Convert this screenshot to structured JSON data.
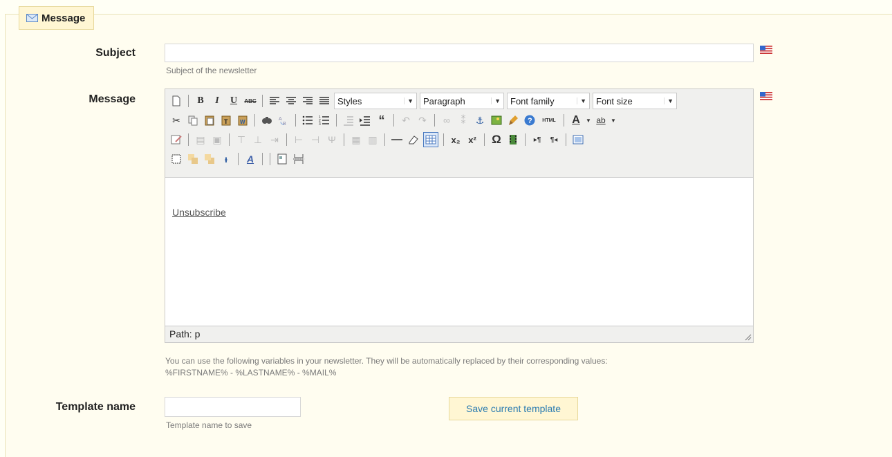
{
  "legend": {
    "title": "Message",
    "icon": "envelope-icon"
  },
  "subject": {
    "label": "Subject",
    "value": "",
    "hint": "Subject of the newsletter"
  },
  "message": {
    "label": "Message",
    "dropdowns": {
      "styles": "Styles",
      "format": "Paragraph",
      "font_family": "Font family",
      "font_size": "Font size"
    },
    "toolbar_text": {
      "bold": "B",
      "italic": "I",
      "underline": "U",
      "strike": "ABC",
      "html": "HTML",
      "color": "A",
      "hilite": "ab",
      "sub": "x₂",
      "sup": "x²",
      "omega": "Ω",
      "quote": "“",
      "font_a": "A"
    },
    "content_link": "Unsubscribe",
    "path": "Path: p",
    "hint_line1": "You can use the following variables in your newsletter. They will be automatically replaced by their corresponding values:",
    "hint_line2": "%FIRSTNAME% - %LASTNAME% - %MAIL%"
  },
  "template": {
    "label": "Template name",
    "value": "",
    "hint": "Template name to save",
    "save_label": "Save current template"
  },
  "colors": {
    "accent_bg": "#fff6d3",
    "accent_border": "#e7d89a",
    "link": "#2a7bb0"
  }
}
